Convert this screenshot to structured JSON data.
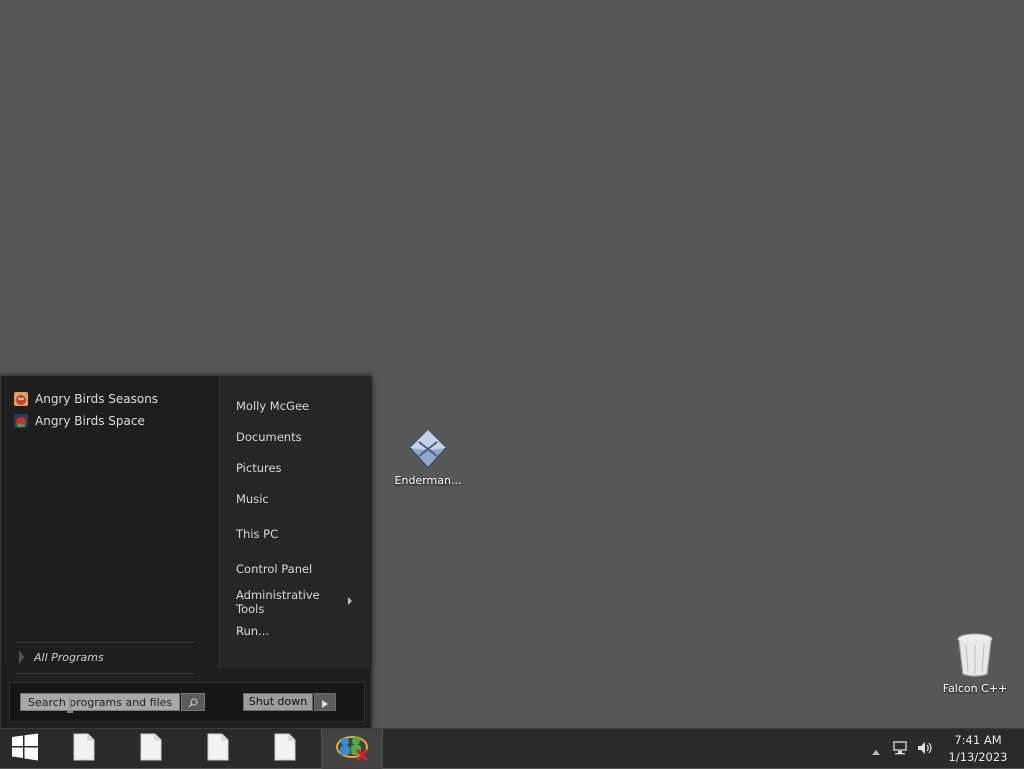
{
  "desktop": {
    "icons": [
      {
        "label": "Enderman...",
        "icon": "package-icon"
      },
      {
        "label": "Falcon C++",
        "icon": "recycle-bin-icon"
      }
    ]
  },
  "start_menu": {
    "programs": [
      {
        "label": "Angry Birds Seasons",
        "icon": "angry-birds-seasons-icon"
      },
      {
        "label": "Angry Birds Space",
        "icon": "angry-birds-space-icon"
      }
    ],
    "all_programs": "All Programs",
    "places": [
      {
        "label": "Molly McGee"
      },
      {
        "label": "Documents"
      },
      {
        "label": "Pictures"
      },
      {
        "label": "Music"
      },
      {
        "label": "This PC"
      },
      {
        "label": "Control Panel"
      },
      {
        "label": "Administrative Tools",
        "line1": "Administrative",
        "line2": "Tools",
        "has_submenu": true
      },
      {
        "label": "Run..."
      }
    ],
    "search_placeholder": "Search programs and files",
    "shutdown_label": "Shut down"
  },
  "taskbar": {
    "start_icon": "windows-logo-icon",
    "buttons": [
      {
        "icon": "document-icon"
      },
      {
        "icon": "document-icon"
      },
      {
        "icon": "document-icon"
      },
      {
        "icon": "document-icon"
      },
      {
        "icon": "network-users-icon",
        "active": true
      }
    ],
    "tray": {
      "time": "7:41 AM",
      "date": "1/13/2023"
    }
  },
  "colors": {
    "desktop_bg": "#585858",
    "menu_bg": "#1f1f1f",
    "taskbar_bg": "#2a2a2a"
  }
}
